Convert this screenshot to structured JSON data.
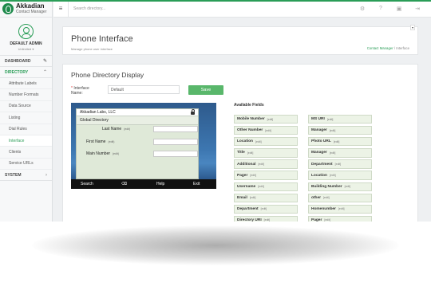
{
  "brand": {
    "name": "Akkadian",
    "product": "Contact Manager"
  },
  "user": {
    "name": "DEFAULT ADMIN",
    "role": "Unlimited"
  },
  "sidebar": {
    "dashboard": "DASHBOARD",
    "directory": "DIRECTORY",
    "system": "SYSTEM",
    "items": [
      "Attribute Labels",
      "Number Formats",
      "Data Source",
      "Listing",
      "Dial Rules",
      "Interface",
      "Clients",
      "Service URLs"
    ]
  },
  "topbar": {
    "search_placeholder": "Search directory..."
  },
  "header": {
    "title": "Phone Interface",
    "subtitle": "Manage phone user interface",
    "breadcrumb_link": "Contact Manager",
    "breadcrumb_sep": "/",
    "breadcrumb_current": "Interface",
    "corner_tag": "▾"
  },
  "main": {
    "title": "Phone Directory Display",
    "form_label_req": "*",
    "form_label": "Interface Name:",
    "input_value": "Default",
    "save_label": "Save"
  },
  "phone": {
    "header": "Akkadian Labs, LLC",
    "group": "Global Directory",
    "rows": [
      {
        "label": "Last Name",
        "edit": "(edit)"
      },
      {
        "label": "First Name",
        "edit": "(edit)"
      },
      {
        "label": "Main Number",
        "edit": "(edit)"
      }
    ],
    "softkeys": [
      "Search",
      "⌫",
      "Help",
      "Exit"
    ]
  },
  "available_fields": {
    "label": "Available Fields",
    "edit": "[edit]",
    "left": [
      "Mobile Number",
      "Other Number",
      "Location",
      "Title",
      "Additional",
      "Pager",
      "Username",
      "Email",
      "Department",
      "Directory URI"
    ],
    "right": [
      "MS URI",
      "Manager",
      "Photo URL",
      "Manager",
      "Department",
      "Location",
      "Building Number",
      "other",
      "Homenumber",
      "Pager"
    ]
  },
  "colors": {
    "accent": "#2a9d57",
    "save": "#59b76b"
  }
}
